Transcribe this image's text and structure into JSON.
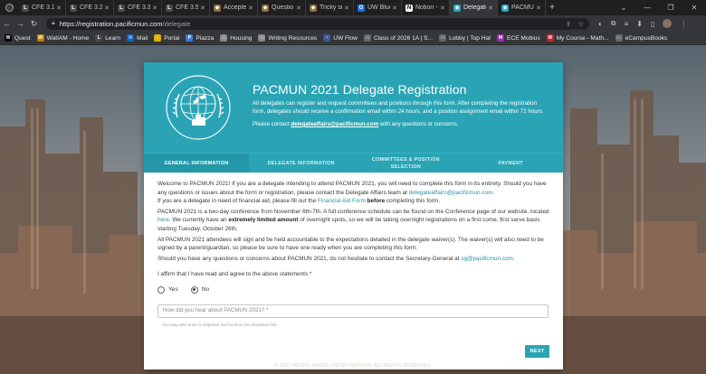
{
  "browser": {
    "tabs": [
      {
        "label": "CFE 3.1",
        "icon": "learn-icon",
        "color": "#4a4a4a",
        "glyph": "L",
        "active": false
      },
      {
        "label": "CFE 3.2 -",
        "icon": "learn-icon",
        "color": "#4a4a4a",
        "glyph": "L",
        "active": false
      },
      {
        "label": "CFE 3.3",
        "icon": "learn-icon",
        "color": "#4a4a4a",
        "glyph": "L",
        "active": false
      },
      {
        "label": "CFE 3.5",
        "icon": "learn-icon",
        "color": "#4a4a4a",
        "glyph": "L",
        "active": false
      },
      {
        "label": "Accepte",
        "icon": "shield-icon",
        "color": "#8d6e3a",
        "glyph": "◆",
        "active": false
      },
      {
        "label": "Questio",
        "icon": "shield-icon",
        "color": "#8d6e3a",
        "glyph": "◆",
        "active": false
      },
      {
        "label": "Tricky si",
        "icon": "shield-icon",
        "color": "#8d6e3a",
        "glyph": "◆",
        "active": false
      },
      {
        "label": "UW Blue",
        "icon": "uw-icon",
        "color": "#1a73e8",
        "glyph": "G",
        "active": false
      },
      {
        "label": "Notion -",
        "icon": "notion-icon",
        "color": "#ffffff",
        "glyph": "N",
        "active": false
      },
      {
        "label": "Delegate",
        "icon": "pacmun-icon",
        "color": "#2aa4b5",
        "glyph": "◉",
        "active": true
      },
      {
        "label": "PACMUN",
        "icon": "pacmun-icon",
        "color": "#2aa4b5",
        "glyph": "◉",
        "active": false
      }
    ],
    "url_host": "https://registration.pacificmun.com",
    "url_path": "/delegate",
    "bookmarks": [
      {
        "label": "Quest",
        "icon": "waterloo-icon",
        "color": "#000000",
        "glyph": "W"
      },
      {
        "label": "WatIAM - Home",
        "icon": "waterloo-icon",
        "color": "#b8860b",
        "glyph": "W"
      },
      {
        "label": "Learn",
        "icon": "learn-icon",
        "color": "#4a4a4a",
        "glyph": "L"
      },
      {
        "label": "Mail",
        "icon": "mail-icon",
        "color": "#0a64c8",
        "glyph": "✉"
      },
      {
        "label": "Portal",
        "icon": "portal-icon",
        "color": "#e0b000",
        "glyph": "○"
      },
      {
        "label": "Piazza",
        "icon": "piazza-icon",
        "color": "#3b7ddd",
        "glyph": "P"
      },
      {
        "label": "Housing",
        "icon": "folder-icon",
        "color": "#888888",
        "glyph": "▭"
      },
      {
        "label": "Writing Resources",
        "icon": "folder-icon",
        "color": "#888888",
        "glyph": "▭"
      },
      {
        "label": "UW Flow",
        "icon": "uwflow-icon",
        "color": "#3b5998",
        "glyph": "~"
      },
      {
        "label": "Class of 2026 1A | S...",
        "icon": "page-icon",
        "color": "#666666",
        "glyph": "▭"
      },
      {
        "label": "Lobby | Top Hat",
        "icon": "page-icon",
        "color": "#666666",
        "glyph": "▭"
      },
      {
        "label": "ECE Mobius",
        "icon": "mobius-icon",
        "color": "#9c27b0",
        "glyph": "M"
      },
      {
        "label": "My Course - Math...",
        "icon": "mobius-icon",
        "color": "#c62828",
        "glyph": "M"
      },
      {
        "label": "eCampusBooks",
        "icon": "page-icon",
        "color": "#666666",
        "glyph": "▭"
      }
    ]
  },
  "form": {
    "title": "PACMUN 2021 Delegate Registration",
    "description": "All delegates can register and request committees and positions through this form. After completing the registration form, delegates should receive a confirmation email within 24 hours, and a position assignment email within 72 hours.",
    "contact_pre": "Please contact",
    "contact_email": "delegateaffairs@pacificmun.com",
    "contact_post": "with any questions or concerns.",
    "tabs": [
      {
        "label": "GENERAL INFORMATION",
        "active": true
      },
      {
        "label": "DELEGATE INFORMATION",
        "active": false
      },
      {
        "label": "COMMITTEES & POSITION SELECTION",
        "active": false
      },
      {
        "label": "PAYMENT",
        "active": false
      }
    ],
    "p1_a": "Welcome to PACMUN 2021! If you are a delegate intending to attend PACMUN 2021, you will need to complete this form in its entirety. Should you have any questions or issues about the form or registration, please contact the Delegate Affairs team at",
    "p1_email": "delegateaffairs@pacificmun.com",
    "p1_b": ".",
    "p2_a": "If you are a delegate in need of financial aid, please fill out the",
    "p2_link": "Financial Aid Form",
    "p2_bold": "before",
    "p2_b": "completing this form.",
    "p3_a": "PACMUN 2021 is a two-day conference from November 6th-7th. A full conference schedule can be found on the Conference page of our website, located",
    "p3_link": "here",
    "p3_b": ". We currently have an",
    "p3_bold": "extremely limited amount",
    "p3_c": "of overnight spots, so we will be taking overnight registrations on a first come, first serve basis starting Tuesday, October 26th.",
    "p4": "All PACMUN 2021 attendees will sign and be held accountable to the expectations detailed in the delegate waiver(s). The waiver(s) will also need to be signed by a parent/guardian, so please be sure to have one ready when you are completing this form.",
    "p5_a": "Should you have any questions or concerns about PACMUN 2021, do not hesitate to contact the Secretary-General at",
    "p5_email": "sg@pacificmun.com",
    "p5_b": ".",
    "affirm_label": "I affirm that I have read and agree to the above statements *",
    "radio_yes": "Yes",
    "radio_no": "No",
    "selected": "No",
    "hear_placeholder": "How did you hear about PACMUN 2021? *",
    "hear_hint": "You may also enter a response not found on the dropdown list.",
    "next_label": "NEXT"
  },
  "footer": "© 2021 PACIFIC MODEL UNITED NATIONS. ALL RIGHTS RESERVED."
}
